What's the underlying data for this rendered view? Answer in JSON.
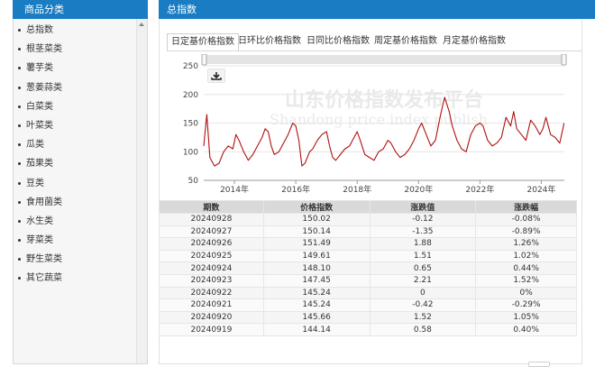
{
  "sidebar": {
    "title": "商品分类",
    "categories": [
      "总指数",
      "根茎菜类",
      "薯芋类",
      "葱姜蒜类",
      "白菜类",
      "叶菜类",
      "瓜类",
      "茄果类",
      "豆类",
      "食用菌类",
      "水生类",
      "芽菜类",
      "野生菜类",
      "其它蔬菜"
    ]
  },
  "main": {
    "title": "总指数",
    "tabs": [
      "日定基价格指数",
      "日环比价格指数",
      "日同比价格指数",
      "周定基价格指数",
      "月定基价格指数"
    ],
    "active_tab": 0
  },
  "chart_data": {
    "type": "line",
    "title": "",
    "watermark": "山东价格指数发布平台",
    "watermark_sub": "Shandong price index publish",
    "xlabel": "",
    "ylabel": "",
    "x_ticks": [
      "2014年",
      "2016年",
      "2018年",
      "2020年",
      "2022年",
      "2024年"
    ],
    "x_range": [
      2013.0,
      2024.75
    ],
    "ylim": [
      50,
      250
    ],
    "y_ticks": [
      50,
      100,
      150,
      200,
      250
    ],
    "grid": true,
    "line_color": "#b01010",
    "series": [
      {
        "name": "",
        "x": [
          2013.0,
          2013.1,
          2013.2,
          2013.35,
          2013.5,
          2013.65,
          2013.8,
          2013.95,
          2014.05,
          2014.15,
          2014.3,
          2014.45,
          2014.6,
          2014.75,
          2014.9,
          2015.0,
          2015.1,
          2015.2,
          2015.3,
          2015.45,
          2015.6,
          2015.75,
          2015.9,
          2016.0,
          2016.1,
          2016.2,
          2016.3,
          2016.45,
          2016.55,
          2016.7,
          2016.85,
          2017.0,
          2017.1,
          2017.2,
          2017.3,
          2017.45,
          2017.6,
          2017.75,
          2017.9,
          2018.0,
          2018.1,
          2018.25,
          2018.4,
          2018.55,
          2018.7,
          2018.85,
          2019.0,
          2019.1,
          2019.25,
          2019.4,
          2019.55,
          2019.7,
          2019.85,
          2020.0,
          2020.1,
          2020.25,
          2020.4,
          2020.55,
          2020.7,
          2020.85,
          2021.0,
          2021.1,
          2021.25,
          2021.4,
          2021.55,
          2021.7,
          2021.85,
          2022.0,
          2022.1,
          2022.25,
          2022.4,
          2022.55,
          2022.7,
          2022.85,
          2023.0,
          2023.1,
          2023.2,
          2023.35,
          2023.5,
          2023.65,
          2023.8,
          2023.95,
          2024.05,
          2024.15,
          2024.3,
          2024.45,
          2024.6,
          2024.74
        ],
        "values": [
          110,
          165,
          90,
          75,
          80,
          100,
          110,
          105,
          130,
          120,
          100,
          85,
          95,
          110,
          125,
          140,
          135,
          110,
          95,
          100,
          115,
          130,
          150,
          145,
          120,
          75,
          80,
          100,
          105,
          120,
          130,
          135,
          110,
          90,
          85,
          95,
          105,
          110,
          125,
          135,
          120,
          95,
          90,
          85,
          100,
          105,
          120,
          115,
          100,
          90,
          95,
          105,
          120,
          140,
          150,
          130,
          110,
          120,
          160,
          195,
          170,
          145,
          120,
          105,
          100,
          130,
          145,
          150,
          145,
          120,
          110,
          115,
          125,
          160,
          145,
          170,
          140,
          130,
          120,
          155,
          145,
          130,
          140,
          160,
          130,
          125,
          115,
          150
        ]
      }
    ]
  },
  "table": {
    "headers": [
      "期数",
      "价格指数",
      "涨跌值",
      "涨跌幅"
    ],
    "rows": [
      [
        "20240928",
        "150.02",
        "-0.12",
        "-0.08%"
      ],
      [
        "20240927",
        "150.14",
        "-1.35",
        "-0.89%"
      ],
      [
        "20240926",
        "151.49",
        "1.88",
        "1.26%"
      ],
      [
        "20240925",
        "149.61",
        "1.51",
        "1.02%"
      ],
      [
        "20240924",
        "148.10",
        "0.65",
        "0.44%"
      ],
      [
        "20240923",
        "147.45",
        "2.21",
        "1.52%"
      ],
      [
        "20240922",
        "145.24",
        "0",
        "0%"
      ],
      [
        "20240921",
        "145.24",
        "-0.42",
        "-0.29%"
      ],
      [
        "20240920",
        "145.66",
        "1.52",
        "1.05%"
      ],
      [
        "20240919",
        "144.14",
        "0.58",
        "0.40%"
      ]
    ]
  },
  "colors": {
    "header_blue": "#1a7cc2",
    "line": "#b01010"
  },
  "icons": {
    "download": "download-icon"
  }
}
